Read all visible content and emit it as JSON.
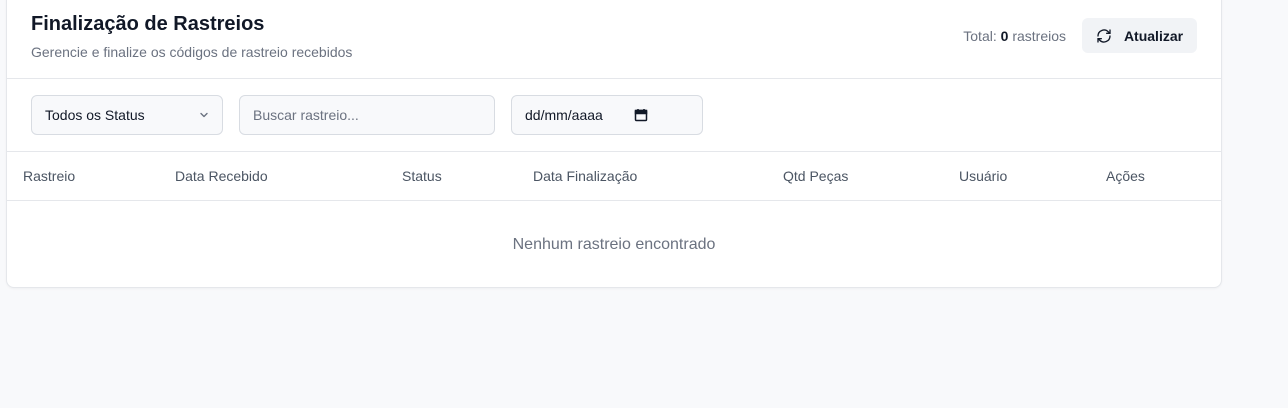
{
  "header": {
    "title": "Finalização de Rastreios",
    "subtitle": "Gerencie e finalize os códigos de rastreio recebidos",
    "total_label": "Total:",
    "total_count": "0",
    "total_suffix": "rastreios",
    "refresh_label": "Atualizar"
  },
  "filters": {
    "status_selected": "Todos os Status",
    "search_placeholder": "Buscar rastreio...",
    "date_placeholder": "dd/mm/aaaa"
  },
  "table": {
    "columns": [
      "Rastreio",
      "Data Recebido",
      "Status",
      "Data Finalização",
      "Qtd Peças",
      "Usuário",
      "Ações"
    ],
    "empty_message": "Nenhum rastreio encontrado"
  },
  "icons": {
    "refresh": "refresh-icon",
    "chevron": "chevron-down-icon",
    "calendar": "calendar-icon"
  }
}
